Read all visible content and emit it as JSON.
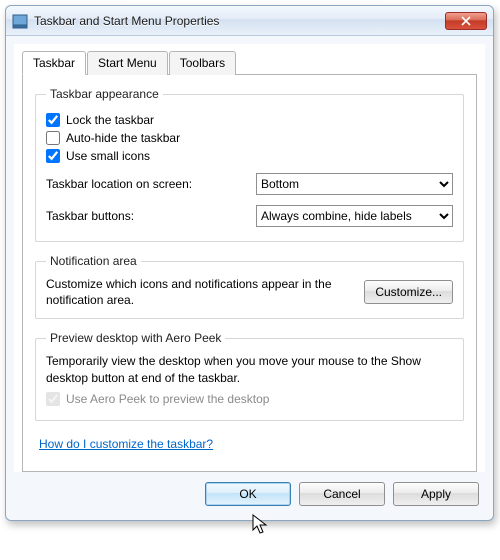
{
  "window": {
    "title": "Taskbar and Start Menu Properties"
  },
  "tabs": {
    "taskbar": "Taskbar",
    "startmenu": "Start Menu",
    "toolbars": "Toolbars"
  },
  "appearance": {
    "legend": "Taskbar appearance",
    "lock_label": "Lock the taskbar",
    "lock_checked": true,
    "autohide_label": "Auto-hide the taskbar",
    "autohide_checked": false,
    "smallicons_label": "Use small icons",
    "smallicons_checked": true,
    "location_label": "Taskbar location on screen:",
    "location_value": "Bottom",
    "buttons_label": "Taskbar buttons:",
    "buttons_value": "Always combine, hide labels"
  },
  "notification": {
    "legend": "Notification area",
    "desc": "Customize which icons and notifications appear in the notification area.",
    "customize_label": "Customize..."
  },
  "aero": {
    "legend": "Preview desktop with Aero Peek",
    "desc": "Temporarily view the desktop when you move your mouse to the Show desktop button at end of the taskbar.",
    "checkbox_label": "Use Aero Peek to preview the desktop",
    "checkbox_checked": true
  },
  "helplink": "How do I customize the taskbar?",
  "buttons": {
    "ok": "OK",
    "cancel": "Cancel",
    "apply": "Apply"
  },
  "icons": {
    "close": "close-icon",
    "app": "taskbar-app-icon"
  }
}
